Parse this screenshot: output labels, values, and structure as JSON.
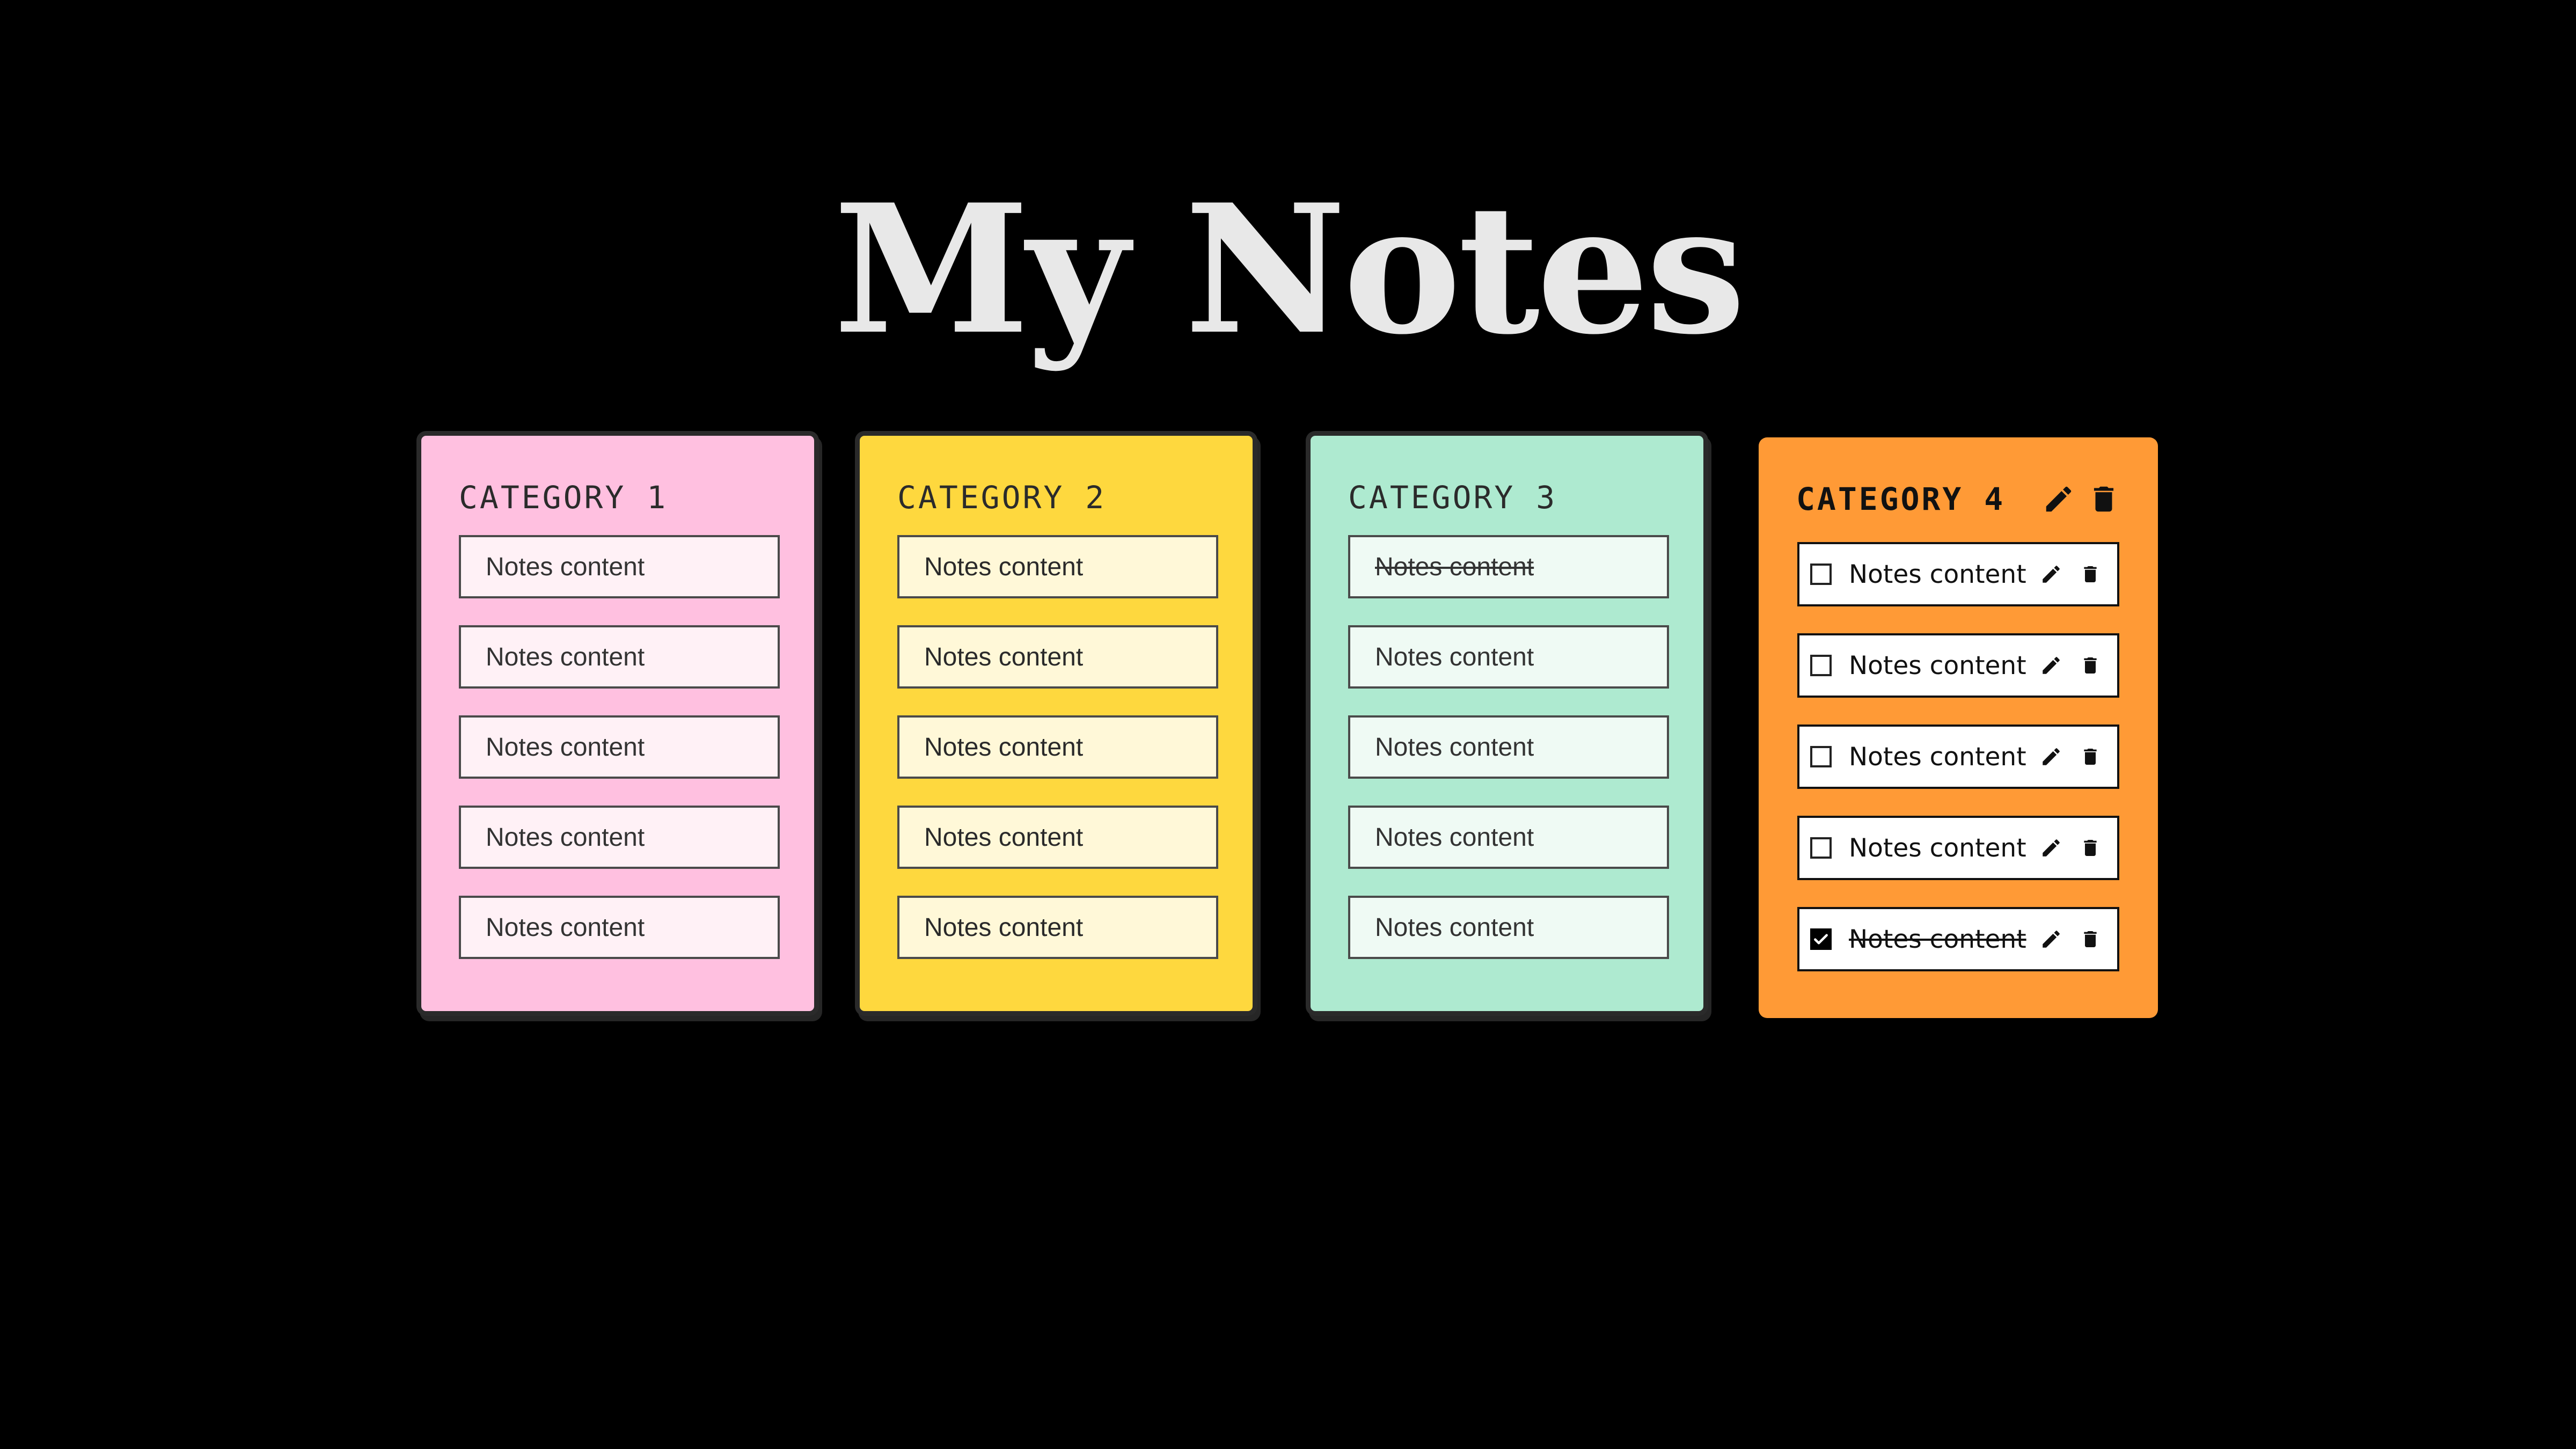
{
  "page": {
    "title": "My Notes",
    "background": "#000000"
  },
  "categories": [
    {
      "title": "CATEGORY 1",
      "color": "#ffc0e0",
      "notes": [
        {
          "text": "Notes content",
          "done": false
        },
        {
          "text": "Notes content",
          "done": false
        },
        {
          "text": "Notes content",
          "done": false
        },
        {
          "text": "Notes content",
          "done": false
        },
        {
          "text": "Notes content",
          "done": false
        }
      ]
    },
    {
      "title": "CATEGORY 2",
      "color": "#fed83e",
      "notes": [
        {
          "text": "Notes content",
          "done": false
        },
        {
          "text": "Notes content",
          "done": false
        },
        {
          "text": "Notes content",
          "done": false
        },
        {
          "text": "Notes content",
          "done": false
        },
        {
          "text": "Notes content",
          "done": false
        }
      ]
    },
    {
      "title": "CATEGORY 3",
      "color": "#aeead0",
      "notes": [
        {
          "text": "Notes content",
          "done": true
        },
        {
          "text": "Notes content",
          "done": false
        },
        {
          "text": "Notes content",
          "done": false
        },
        {
          "text": "Notes content",
          "done": false
        },
        {
          "text": "Notes content",
          "done": false
        }
      ]
    },
    {
      "title": "CATEGORY 4",
      "color": "#ff9a36",
      "header_icons": [
        "pencil-icon",
        "trash-icon"
      ],
      "notes": [
        {
          "text": "Notes content",
          "checked": false,
          "done": false
        },
        {
          "text": "Notes content",
          "checked": false,
          "done": false
        },
        {
          "text": "Notes content",
          "checked": false,
          "done": false
        },
        {
          "text": "Notes content",
          "checked": false,
          "done": false
        },
        {
          "text": "Notes content",
          "checked": true,
          "done": true
        }
      ],
      "note_icons": [
        "pencil-icon",
        "trash-icon"
      ]
    }
  ]
}
